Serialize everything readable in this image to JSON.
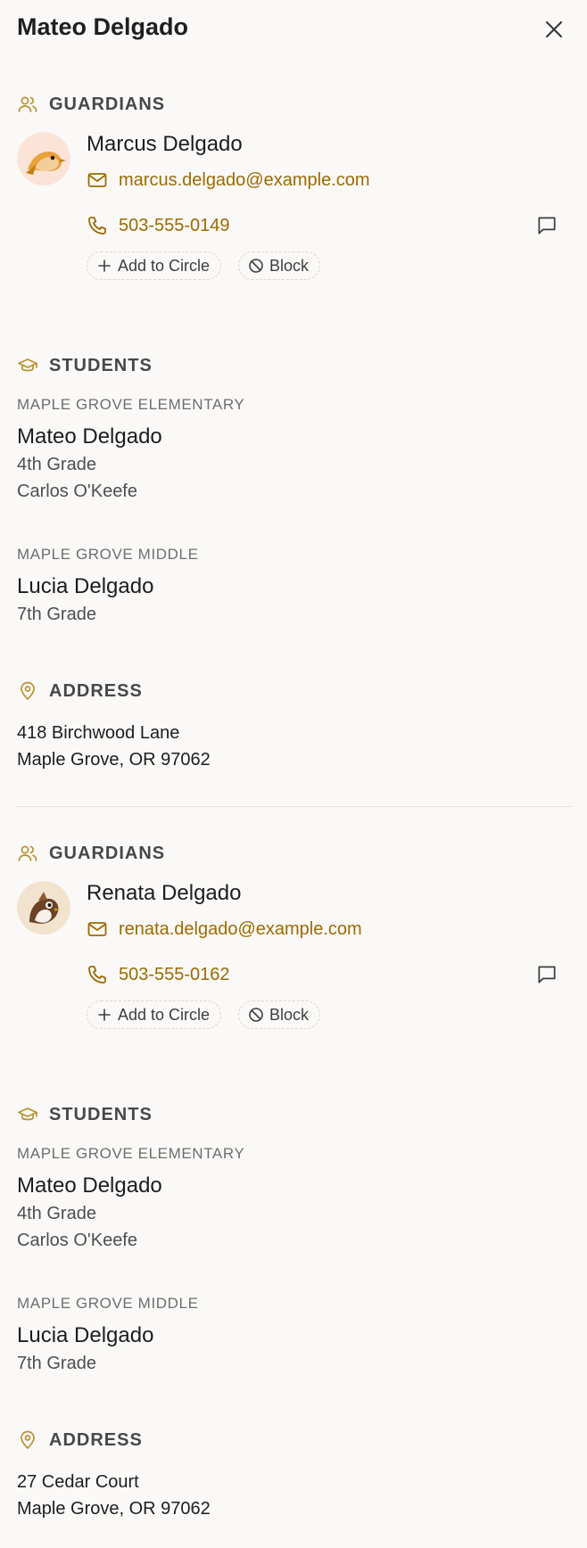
{
  "header": {
    "title": "Mateo Delgado"
  },
  "records": [
    {
      "guardians_label": "GUARDIANS",
      "guardian": {
        "name": "Marcus Delgado",
        "email": "marcus.delgado@example.com",
        "phone": "503-555-0149",
        "add_to_circle_label": "Add to Circle",
        "block_label": "Block"
      },
      "students_label": "STUDENTS",
      "students": [
        {
          "school": "MAPLE GROVE ELEMENTARY",
          "name": "Mateo Delgado",
          "grade": "4th Grade",
          "teacher": "Carlos O'Keefe"
        },
        {
          "school": "MAPLE GROVE MIDDLE",
          "name": "Lucia Delgado",
          "grade": "7th Grade"
        }
      ],
      "address_label": "ADDRESS",
      "address": {
        "line1": "418 Birchwood Lane",
        "line2": "Maple Grove, OR 97062"
      }
    },
    {
      "guardians_label": "GUARDIANS",
      "guardian": {
        "name": "Renata Delgado",
        "email": "renata.delgado@example.com",
        "phone": "503-555-0162",
        "add_to_circle_label": "Add to Circle",
        "block_label": "Block"
      },
      "students_label": "STUDENTS",
      "students": [
        {
          "school": "MAPLE GROVE ELEMENTARY",
          "name": "Mateo Delgado",
          "grade": "4th Grade",
          "teacher": "Carlos O'Keefe"
        },
        {
          "school": "MAPLE GROVE MIDDLE",
          "name": "Lucia Delgado",
          "grade": "7th Grade"
        }
      ],
      "address_label": "ADDRESS",
      "address": {
        "line1": "27 Cedar Court",
        "line2": "Maple Grove, OR 97062"
      }
    }
  ],
  "colors": {
    "accent": "#9c6a00",
    "icon_accent": "#b8922e",
    "background": "#faf9f7"
  },
  "icons": {
    "close": "close-icon",
    "guardians": "users-icon",
    "students": "graduation-cap-icon",
    "address": "map-pin-icon",
    "email": "mail-icon",
    "phone": "phone-icon",
    "message": "message-icon",
    "add": "plus-icon",
    "block": "block-icon"
  }
}
